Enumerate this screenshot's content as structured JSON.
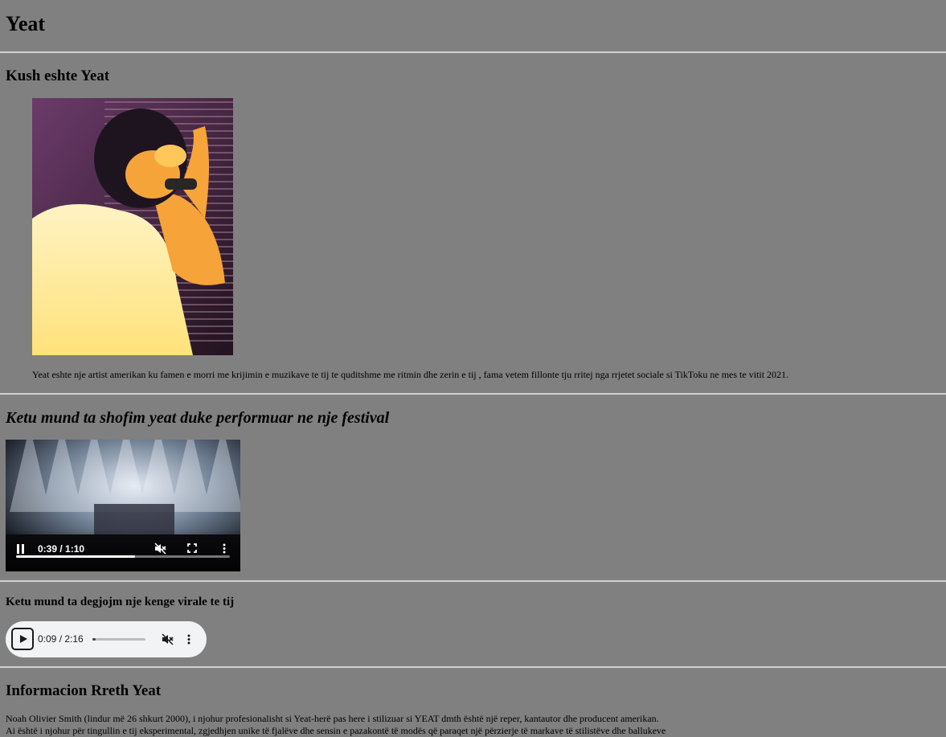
{
  "page": {
    "title": "Yeat"
  },
  "section1": {
    "heading": "Kush eshte Yeat",
    "photo_alt": "Yeat",
    "paragraph": "Yeat eshte nje artist amerikan ku famen e morri me krijimin e muzikave te tij te quditshme me ritmin dhe zerin e tij , fama vetem fillonte tju rritej nga rrjetet sociale si TikToku ne mes te vitit 2021."
  },
  "section2": {
    "heading": "Ketu mund ta shofim yeat duke performuar ne nje festival",
    "video": {
      "time": "0:39 / 1:10",
      "progress": 0.557,
      "state": "playing",
      "muted": true,
      "icons": [
        "pause-icon",
        "mute-icon",
        "fullscreen-icon",
        "more-options-icon"
      ]
    }
  },
  "section3": {
    "heading": "Ketu mund ta degjojm nje kenge virale te tij",
    "audio": {
      "time": "0:09 / 2:16",
      "progress": 0.066,
      "state": "paused",
      "muted": true,
      "icons": [
        "play-icon",
        "mute-icon",
        "more-options-icon"
      ]
    }
  },
  "section4": {
    "heading": "Informacion Rreth Yeat",
    "line1": "Noah Olivier Smith (lindur më 26 shkurt 2000), i njohur profesionalisht si Yeat-herë pas here i stilizuar si YEAT dmth është një reper, kantautor dhe producent amerikan.",
    "line2": "Ai është i njohur për tingullin e tij eksperimental, zgjedhjen unike të fjalëve dhe sensin e pazakontë të modës që paraqet një përzierje të markave të stilistëve dhe ballukeve"
  },
  "colors": {
    "background": "#808080",
    "rule": "#d0d0d0",
    "audio_bg": "#f1f3f4"
  }
}
